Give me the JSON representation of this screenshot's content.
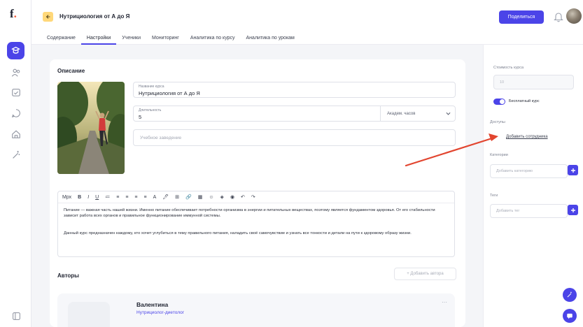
{
  "app": {
    "logo": "f"
  },
  "header": {
    "course_title": "Нутрициология от А до Я",
    "share_label": "Поделиться"
  },
  "tabs": [
    {
      "label": "Содержание"
    },
    {
      "label": "Настройки"
    },
    {
      "label": "Ученики"
    },
    {
      "label": "Мониторинг"
    },
    {
      "label": "Аналитика по курсу"
    },
    {
      "label": "Аналитика по урокам"
    }
  ],
  "description": {
    "section_title": "Описание",
    "name_label": "Название курса",
    "name_value": "Нутрициология от А до Я",
    "duration_label": "Длительность",
    "duration_value": "5",
    "duration_unit": "Академ. часов",
    "institution_placeholder": "Учебное заведение"
  },
  "editor": {
    "toolbar": [
      "Мрх",
      "B",
      "I",
      "U",
      "≔",
      "≡",
      "≡",
      "≡",
      "≡",
      "A",
      "🖊",
      "⊞",
      "🔗",
      "▦",
      "☺",
      "◈",
      "◉",
      "↶",
      "↷"
    ],
    "paragraph1": "Питание — важная часть нашей жизни. Именно питание обеспечивает потребности организма в энергии и питательных веществах, поэтому является фундаментом здоровья. От его стабильности зависит работа всех органов и правильное функционирование иммунной системы.",
    "paragraph2": "Данный курс предназначен каждому, кто хочет углубиться в тему правильного питания, наладить своё самочувствие и узнать все тонкости и детали на пути к здоровому образу жизни."
  },
  "authors": {
    "section_title": "Авторы",
    "add_label": "+ Добавить автора",
    "items": [
      {
        "name": "Валентина",
        "role": "Нутрициолог-диетолог"
      }
    ]
  },
  "settings": {
    "price_label": "Стоимость курса",
    "price_value": "10",
    "free_label": "Бесплатный курс",
    "access_label": "Доступы",
    "add_employee_label": "Добавить сотрудника",
    "category_label": "Категории",
    "category_placeholder": "Добавить категорию",
    "tags_label": "Теги",
    "tags_placeholder": "Добавить тег"
  },
  "colors": {
    "accent": "#4b44e8",
    "arrow": "#e2452f",
    "back_button": "#ffd87a"
  }
}
